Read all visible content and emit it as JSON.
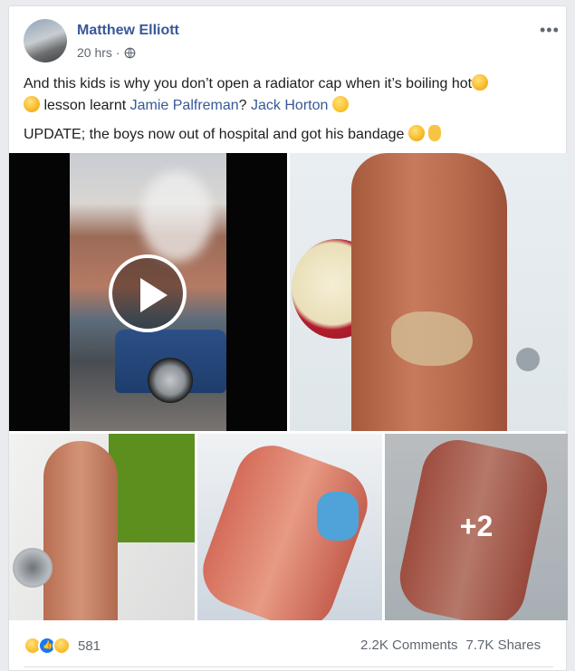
{
  "post": {
    "author": "Matthew Elliott",
    "time": "20 hrs",
    "separator": "·",
    "privacy_icon": "globe-icon",
    "more_options": "•••",
    "text_line1": "And this kids is why you don’t open a radiator cap when it’s boiling hot",
    "text_lesson": "lesson learnt",
    "mention1": "Jamie Palfreman",
    "mention_sep": "?",
    "mention2": "Jack Horton",
    "update_text": "UPDATE; the boys now out of hospital and got his bandage"
  },
  "media": {
    "items": [
      {
        "name": "video-thumbnail",
        "type": "video"
      },
      {
        "name": "photo-2",
        "type": "image"
      },
      {
        "name": "photo-3",
        "type": "image"
      },
      {
        "name": "photo-4",
        "type": "image"
      },
      {
        "name": "photo-5",
        "type": "image"
      }
    ],
    "more_count": "+2"
  },
  "engagement": {
    "reaction_icons": [
      "haha-icon",
      "like-icon",
      "wow-icon"
    ],
    "reaction_count": "581",
    "comments": "2.2K Comments",
    "shares": "7.7K Shares"
  },
  "colors": {
    "link": "#385898",
    "meta": "#606770",
    "text": "#1c1e21"
  }
}
